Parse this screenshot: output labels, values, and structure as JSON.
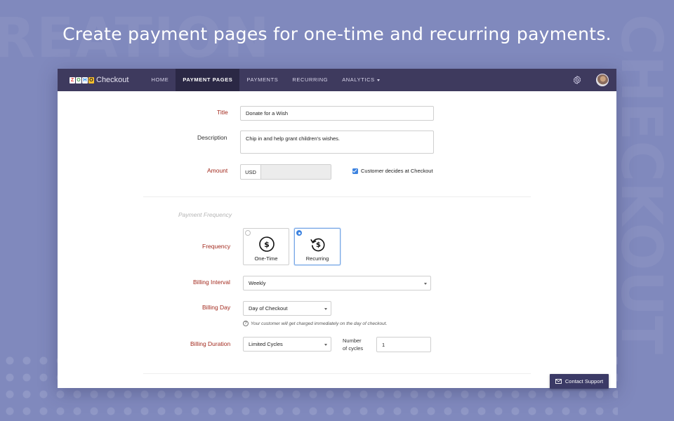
{
  "headline": "Create payment pages for one-time and recurring payments.",
  "background_words": {
    "left": "REATION",
    "right": "CHECKOUT"
  },
  "app": {
    "logo_letters": [
      "Z",
      "O",
      "H",
      "O"
    ],
    "logo_text": "Checkout",
    "nav": [
      {
        "label": "HOME",
        "active": false
      },
      {
        "label": "PAYMENT PAGES",
        "active": true
      },
      {
        "label": "PAYMENTS",
        "active": false
      },
      {
        "label": "RECURRING",
        "active": false
      },
      {
        "label": "ANALYTICS",
        "active": false
      }
    ],
    "icons": {
      "settings": "gear-icon",
      "user": "avatar"
    },
    "colors": {
      "topbar": "#3e3a5e",
      "active_nav": "#2b2845",
      "required_label": "#a32b1f",
      "accent": "#3d83e0"
    }
  },
  "form": {
    "title": {
      "label": "Title",
      "value": "Donate for a Wish"
    },
    "description": {
      "label": "Description",
      "value": "Chip in and help grant children's wishes."
    },
    "amount": {
      "label": "Amount",
      "currency": "USD",
      "value": "",
      "customer_decides_label": "Customer decides at Checkout",
      "customer_decides_checked": true
    },
    "payment_frequency_section": "Payment Frequency",
    "frequency": {
      "label": "Frequency",
      "options": [
        {
          "label": "One-Time",
          "selected": false,
          "icon": "dollar-circle-icon"
        },
        {
          "label": "Recurring",
          "selected": true,
          "icon": "recurring-dollar-icon"
        }
      ]
    },
    "billing_interval": {
      "label": "Billing Interval",
      "value": "Weekly"
    },
    "billing_day": {
      "label": "Billing Day",
      "value": "Day of Checkout",
      "hint": "Your customer will get charged immediately on the day of checkout."
    },
    "billing_duration": {
      "label": "Billing Duration",
      "value": "Limited Cycles",
      "cycles_label_line1": "Number",
      "cycles_label_line2": "of cycles",
      "cycles_value": "1"
    }
  },
  "support": {
    "label": "Contact Support",
    "icon": "mail-icon"
  }
}
